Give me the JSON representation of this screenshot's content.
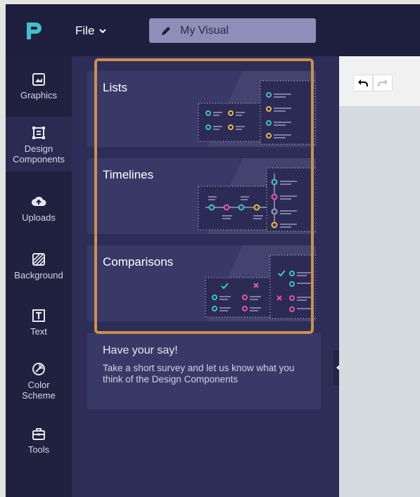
{
  "header": {
    "file_menu_label": "File",
    "document_title": "My Visual"
  },
  "sidebar": {
    "items": [
      {
        "label_lines": [
          "Graphics"
        ],
        "icon": "image-icon"
      },
      {
        "label_lines": [
          "Design",
          "Components"
        ],
        "icon": "components-icon",
        "active": true
      },
      {
        "label_lines": [
          "Uploads"
        ],
        "icon": "cloud-upload-icon"
      },
      {
        "label_lines": [
          "Background"
        ],
        "icon": "background-pattern-icon"
      },
      {
        "label_lines": [
          "Text"
        ],
        "icon": "text-box-icon"
      },
      {
        "label_lines": [
          "Color",
          "Scheme"
        ],
        "icon": "palette-icon"
      },
      {
        "label_lines": [
          "Tools"
        ],
        "icon": "toolbox-icon"
      }
    ]
  },
  "panel": {
    "cards": [
      {
        "title": "Lists"
      },
      {
        "title": "Timelines"
      },
      {
        "title": "Comparisons"
      }
    ],
    "survey": {
      "heading": "Have your say!",
      "body": "Take a short survey and let us know what you think of the Design Components"
    }
  },
  "colors": {
    "accent_teal": "#3ec1c9",
    "accent_yellow": "#e8b94a",
    "accent_pink": "#e05a9b",
    "accent_green": "#4cc9a8",
    "highlight_orange": "#cf8e4f"
  }
}
